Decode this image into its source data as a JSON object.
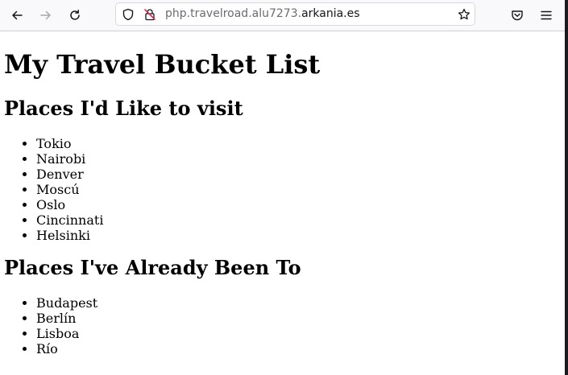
{
  "browser": {
    "url_subdomain": "php.travelroad.alu7273.",
    "url_domain": "arkania.es"
  },
  "page": {
    "title": "My Travel Bucket List",
    "wishlist_heading": "Places I'd Like to visit",
    "wishlist": [
      "Tokio",
      "Nairobi",
      "Denver",
      "Moscú",
      "Oslo",
      "Cincinnati",
      "Helsinki"
    ],
    "visited_heading": "Places I've Already Been To",
    "visited": [
      "Budapest",
      "Berlín",
      "Lisboa",
      "Río"
    ]
  }
}
